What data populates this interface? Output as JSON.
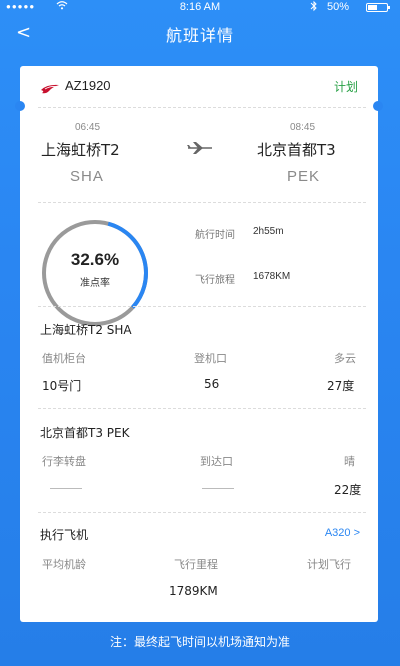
{
  "status_bar": {
    "signal_dots": "●●●●●",
    "wifi_icon": "wifi-icon",
    "time": "8:16 AM",
    "bluetooth_icon": "bluetooth-icon",
    "battery_pct": "50%"
  },
  "nav": {
    "back_label": "<",
    "title": "航班详情"
  },
  "flight": {
    "airline_logo": "china-eastern-logo",
    "number": "AZ1920",
    "status": "计划",
    "status_color": "#27a045"
  },
  "route": {
    "dep_time": "06:45",
    "dep_city": "上海虹桥T2",
    "dep_code": "SHA",
    "arr_time": "08:45",
    "arr_city": "北京首都T3",
    "arr_code": "PEK"
  },
  "punctuality": {
    "value": "32.6%",
    "fraction": 0.326,
    "label": "准点率",
    "accent": "#2a86f2"
  },
  "flight_info": {
    "duration_label": "航行时间",
    "duration_value": "2h55m",
    "distance_label": "飞行旅程",
    "distance_value": "1678KM"
  },
  "departure_airport": {
    "title": "上海虹桥T2 SHA",
    "checkin_label": "值机柜台",
    "checkin_value": "10号门",
    "gate_label": "登机口",
    "gate_value": "56",
    "weather_label": "多云",
    "weather_value": "27度"
  },
  "arrival_airport": {
    "title": "北京首都T3 PEK",
    "baggage_label": "行李转盘",
    "arrival_gate_label": "到达口",
    "weather_label": "晴",
    "weather_value": "22度"
  },
  "aircraft": {
    "title": "执行飞机",
    "model_link": "A320 >",
    "age_label": "平均机龄",
    "mileage_label": "飞行里程",
    "planned_label": "计划飞行",
    "mileage_value": "1789KM"
  },
  "footer": {
    "note": "注：最终起飞时间以机场通知为准"
  }
}
